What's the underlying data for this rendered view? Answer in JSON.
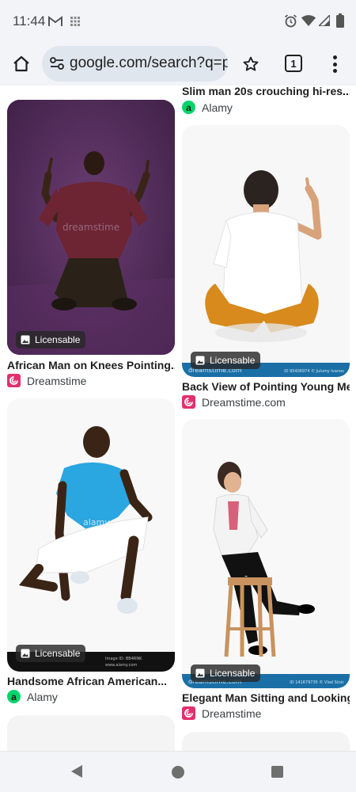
{
  "status_bar": {
    "time": "11:44",
    "icons": [
      "gmail-icon",
      "app-grid-icon",
      "alarm-icon",
      "wifi-icon",
      "signal-icon",
      "battery-icon"
    ]
  },
  "browser": {
    "url": "google.com/search?q=p",
    "tab_count": "1",
    "icons": [
      "home-icon",
      "site-settings-icon",
      "bookmark-star-icon",
      "tabs-icon",
      "more-vert-icon"
    ]
  },
  "results": {
    "left_column": [
      {
        "title": "African Man on Knees Pointing...",
        "source": "Dreamstime",
        "source_icon": "dreamstime-icon",
        "badge": "Licensable"
      },
      {
        "title": "Handsome African American...",
        "source": "Alamy",
        "source_icon": "alamy-icon",
        "badge": "Licensable"
      }
    ],
    "right_column": [
      {
        "title": "Slim man 20s crouching hi-res...",
        "source": "Alamy",
        "source_icon": "alamy-icon"
      },
      {
        "title": "Back View of Pointing Young Me...",
        "source": "Dreamstime.com",
        "source_icon": "dreamstime-icon",
        "badge": "Licensable"
      },
      {
        "title": "Elegant Man Sitting and Looking...",
        "source": "Dreamstime",
        "source_icon": "dreamstime-icon",
        "badge": "Licensable"
      }
    ],
    "alamy_letter": "a",
    "thumbnail_text": {
      "dreamstime_watermark": "dreamstime",
      "footer_site": "dreamstime.com",
      "image_id_back_view": "ID 95406974 © Julumy Ivanov",
      "image_id_sitting": "ID 141679735 © Vlad Stoic",
      "alamy_watermark": "alamy",
      "alamy_footer_site": "www.alamy.com",
      "alamy_image_id": "Image ID: BB4RNK"
    }
  },
  "colors": {
    "chrome_bg": "#f2f4f7",
    "url_pill": "#dfe6ee",
    "dreamstime_brand": "#e3306c",
    "alamy_brand": "#00d56a",
    "thumb_purple": "#4e2a58",
    "stock_footer_blue": "#1a6fa6"
  },
  "nav_bar": {
    "icons": [
      "back-icon",
      "home-circle-icon",
      "recents-icon"
    ]
  }
}
